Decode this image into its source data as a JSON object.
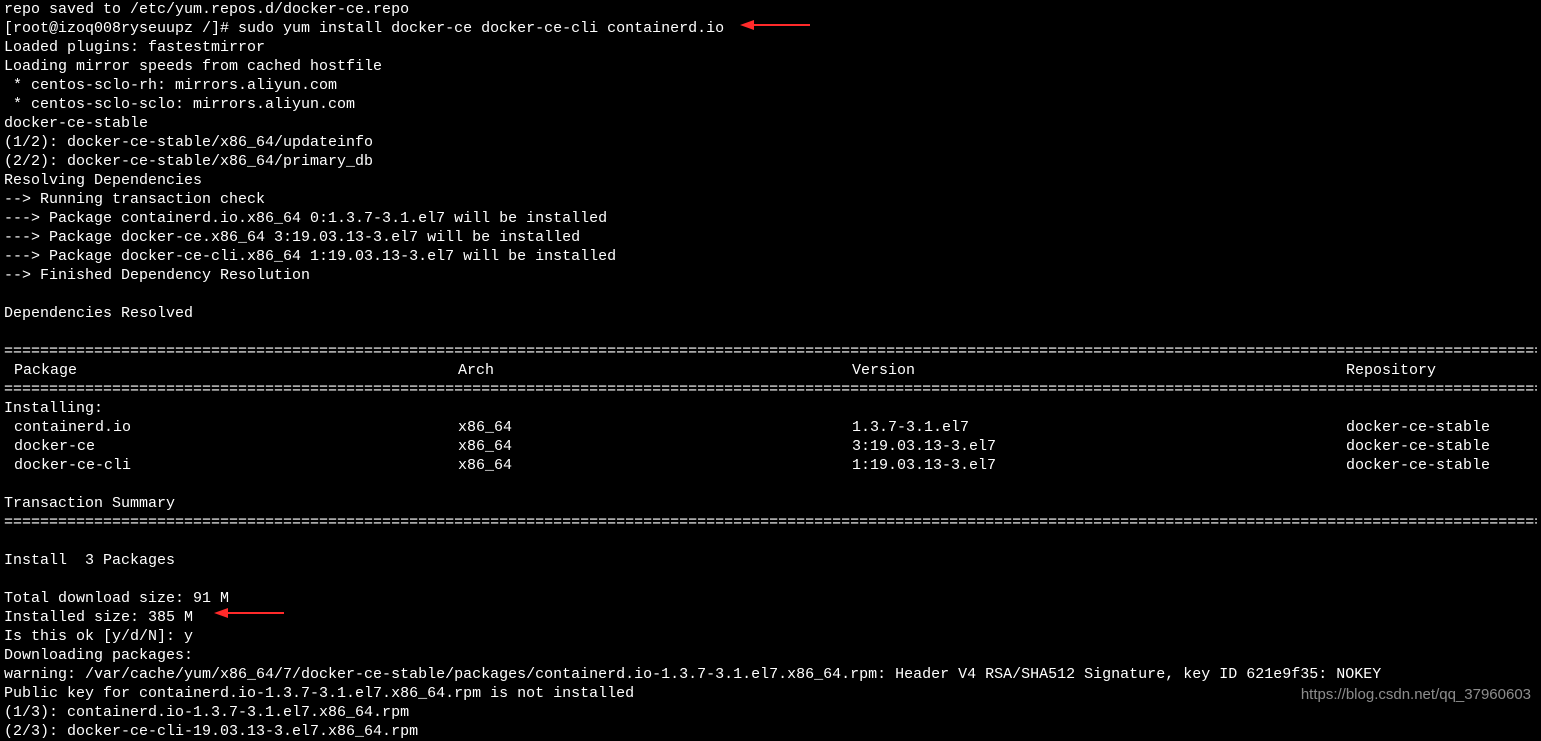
{
  "prompt": "[root@izoq008ryseuupz /]# ",
  "command": "sudo yum install docker-ce docker-ce-cli containerd.io",
  "pre_lines": [
    "repo saved to /etc/yum.repos.d/docker-ce.repo"
  ],
  "post_cmd_lines": [
    "Loaded plugins: fastestmirror",
    "Loading mirror speeds from cached hostfile",
    " * centos-sclo-rh: mirrors.aliyun.com",
    " * centos-sclo-sclo: mirrors.aliyun.com",
    "docker-ce-stable",
    "(1/2): docker-ce-stable/x86_64/updateinfo",
    "(2/2): docker-ce-stable/x86_64/primary_db",
    "Resolving Dependencies",
    "--> Running transaction check",
    "---> Package containerd.io.x86_64 0:1.3.7-3.1.el7 will be installed",
    "---> Package docker-ce.x86_64 3:19.03.13-3.el7 will be installed",
    "---> Package docker-ce-cli.x86_64 1:19.03.13-3.el7 will be installed",
    "--> Finished Dependency Resolution",
    "",
    "Dependencies Resolved",
    ""
  ],
  "table": {
    "headers": {
      "package": "Package",
      "arch": "Arch",
      "version": "Version",
      "repo": "Repository"
    },
    "section_label": "Installing:",
    "rows": [
      {
        "package": "containerd.io",
        "arch": "x86_64",
        "version": "1.3.7-3.1.el7",
        "repo": "docker-ce-stable"
      },
      {
        "package": "docker-ce",
        "arch": "x86_64",
        "version": "3:19.03.13-3.el7",
        "repo": "docker-ce-stable"
      },
      {
        "package": "docker-ce-cli",
        "arch": "x86_64",
        "version": "1:19.03.13-3.el7",
        "repo": "docker-ce-stable"
      }
    ]
  },
  "summary_lines_1": [
    "",
    "Transaction Summary"
  ],
  "summary_lines_2": [
    "",
    "Install  3 Packages",
    "",
    "Total download size: 91 M",
    "Installed size: 385 M"
  ],
  "confirm_prompt": "Is this ok [y/d/N]: ",
  "confirm_answer": "y",
  "tail_lines": [
    "Downloading packages:",
    "warning: /var/cache/yum/x86_64/7/docker-ce-stable/packages/containerd.io-1.3.7-3.1.el7.x86_64.rpm: Header V4 RSA/SHA512 Signature, key ID 621e9f35: NOKEY",
    "Public key for containerd.io-1.3.7-3.1.el7.x86_64.rpm is not installed",
    "(1/3): containerd.io-1.3.7-3.1.el7.x86_64.rpm",
    "(2/3): docker-ce-cli-19.03.13-3.el7.x86_64.rpm"
  ],
  "divider": "================================================================================================================================================================================================",
  "watermark": "https://blog.csdn.net/qq_37960603"
}
